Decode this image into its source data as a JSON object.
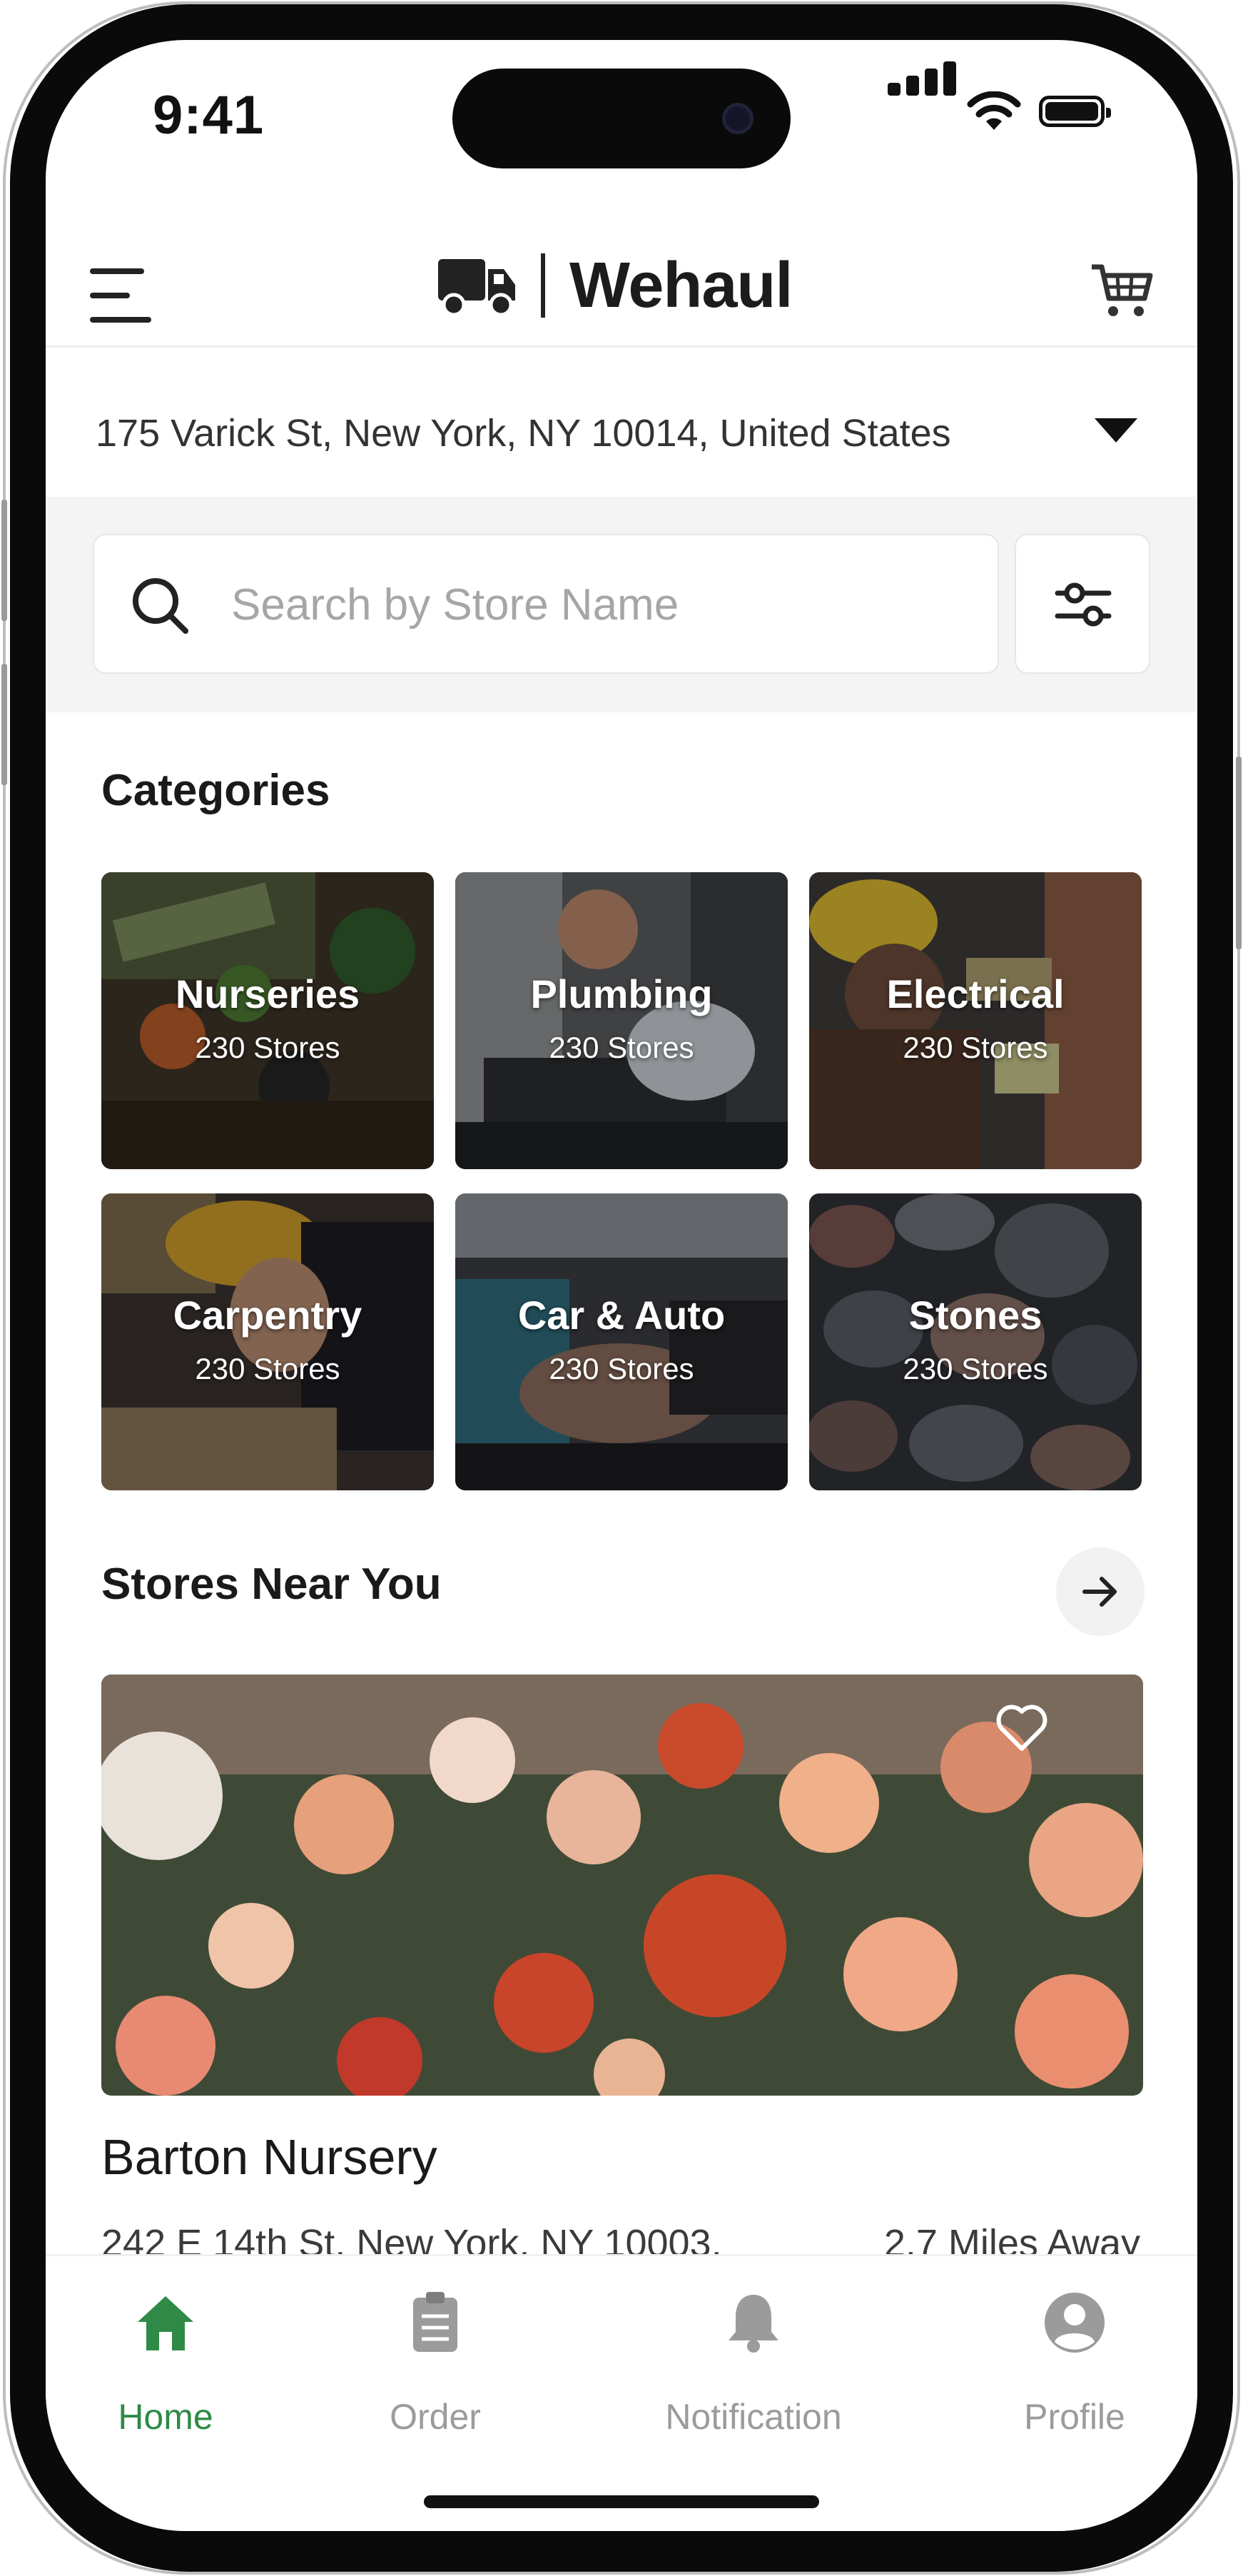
{
  "status_bar": {
    "time": "9:41"
  },
  "header": {
    "brand_name": "Wehaul"
  },
  "address": {
    "text": "175 Varick St, New York, NY 10014, United States"
  },
  "search": {
    "placeholder": "Search by Store Name"
  },
  "categories": {
    "title": "Categories",
    "items": [
      {
        "name": "Nurseries",
        "count": "230 Stores"
      },
      {
        "name": "Plumbing",
        "count": "230 Stores"
      },
      {
        "name": "Electrical",
        "count": "230 Stores"
      },
      {
        "name": "Carpentry",
        "count": "230 Stores"
      },
      {
        "name": "Car & Auto",
        "count": "230 Stores"
      },
      {
        "name": "Stones",
        "count": "230 Stores"
      }
    ]
  },
  "stores_near_you": {
    "title": "Stores Near You",
    "store": {
      "name": "Barton Nursery",
      "address": "242 E 14th St, New York, NY 10003,",
      "distance": "2.7 Miles Away"
    }
  },
  "bottom_nav": {
    "items": [
      {
        "label": "Home",
        "active": true
      },
      {
        "label": "Order",
        "active": false
      },
      {
        "label": "Notification",
        "active": false
      },
      {
        "label": "Profile",
        "active": false
      }
    ]
  },
  "colors": {
    "accent": "#2f8a47",
    "text": "#1a1a1a",
    "muted": "#9b9b9b"
  }
}
